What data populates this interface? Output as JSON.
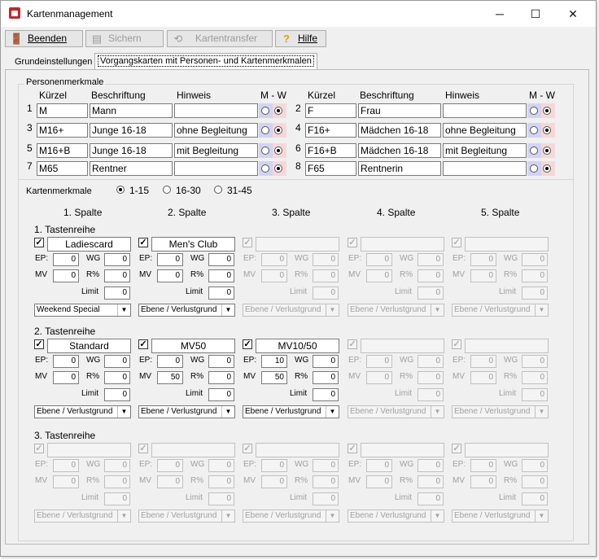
{
  "window": {
    "title": "Kartenmanagement",
    "minimize": "─",
    "maximize": "☐",
    "close": "✕"
  },
  "toolbar": {
    "beenden": "Beenden",
    "sichern": "Sichern",
    "kartentransfer": "Kartentransfer",
    "hilfe": "Hilfe"
  },
  "tabs": [
    "Grundeinstellungen",
    "Vorgangskarten mit Personen- und Kartenmerkmalen"
  ],
  "personen": {
    "legend": "Personenmerkmale",
    "headers": {
      "kuerzel": "Kürzel",
      "beschriftung": "Beschriftung",
      "hinweis": "Hinweis",
      "mw": "M - W"
    },
    "rows": [
      {
        "num": "1",
        "kuerzel": "M",
        "beschriftung": "Mann",
        "hinweis": "",
        "selected": "W"
      },
      {
        "num": "2",
        "kuerzel": "F",
        "beschriftung": "Frau",
        "hinweis": "",
        "selected": "W"
      },
      {
        "num": "3",
        "kuerzel": "M16+",
        "beschriftung": "Junge 16-18",
        "hinweis": "ohne Begleitung",
        "selected": "W"
      },
      {
        "num": "4",
        "kuerzel": "F16+",
        "beschriftung": "Mädchen 16-18",
        "hinweis": "ohne Begleitung",
        "selected": "W"
      },
      {
        "num": "5",
        "kuerzel": "M16+B",
        "beschriftung": "Junge 16-18",
        "hinweis": "mit Begleitung",
        "selected": "W"
      },
      {
        "num": "6",
        "kuerzel": "F16+B",
        "beschriftung": "Mädchen 16-18",
        "hinweis": "mit Begleitung",
        "selected": "W"
      },
      {
        "num": "7",
        "kuerzel": "M65",
        "beschriftung": "Rentner",
        "hinweis": "",
        "selected": "W"
      },
      {
        "num": "8",
        "kuerzel": "F65",
        "beschriftung": "Rentnerin",
        "hinweis": "",
        "selected": "W"
      }
    ],
    "mw_colors": {
      "m": "#d3d3f4",
      "w": "#f6d8d8"
    }
  },
  "kartenmerkmale": {
    "label": "Kartenmerkmale",
    "options": [
      "1-15",
      "16-30",
      "31-45"
    ],
    "selected": "1-15"
  },
  "spalten": [
    "1. Spalte",
    "2. Spalte",
    "3. Spalte",
    "4. Spalte",
    "5. Spalte"
  ],
  "field_labels": {
    "ep": "EP:",
    "wg": "WG",
    "mv": "MV",
    "r": "R%",
    "limit": "Limit"
  },
  "reihen": [
    {
      "title": "1. Tastenreihe",
      "cards": [
        {
          "enabled": true,
          "checked": true,
          "name": "Ladiescard",
          "ep": "0",
          "wg": "0",
          "mv": "0",
          "r": "0",
          "limit": "0",
          "select": "Weekend Special"
        },
        {
          "enabled": true,
          "checked": true,
          "name": "Men's Club",
          "ep": "0",
          "wg": "0",
          "mv": "0",
          "r": "0",
          "limit": "0",
          "select": "Ebene / Verlustgrund"
        },
        {
          "enabled": false,
          "checked": true,
          "name": "",
          "ep": "0",
          "wg": "0",
          "mv": "0",
          "r": "0",
          "limit": "0",
          "select": "Ebene / Verlustgrund"
        },
        {
          "enabled": false,
          "checked": true,
          "name": "",
          "ep": "0",
          "wg": "0",
          "mv": "0",
          "r": "0",
          "limit": "0",
          "select": "Ebene / Verlustgrund"
        },
        {
          "enabled": false,
          "checked": true,
          "name": "",
          "ep": "0",
          "wg": "0",
          "mv": "0",
          "r": "0",
          "limit": "0",
          "select": "Ebene / Verlustgrund"
        }
      ]
    },
    {
      "title": "2. Tastenreihe",
      "cards": [
        {
          "enabled": true,
          "checked": true,
          "name": "Standard",
          "ep": "0",
          "wg": "0",
          "mv": "0",
          "r": "0",
          "limit": "0",
          "select": "Ebene / Verlustgrund"
        },
        {
          "enabled": true,
          "checked": true,
          "name": "MV50",
          "ep": "0",
          "wg": "0",
          "mv": "50",
          "r": "0",
          "limit": "0",
          "select": "Ebene / Verlustgrund"
        },
        {
          "enabled": true,
          "checked": true,
          "name": "MV10/50",
          "ep": "10",
          "wg": "0",
          "mv": "50",
          "r": "0",
          "limit": "0",
          "select": "Ebene / Verlustgrund"
        },
        {
          "enabled": false,
          "checked": true,
          "name": "",
          "ep": "0",
          "wg": "0",
          "mv": "0",
          "r": "0",
          "limit": "0",
          "select": "Ebene / Verlustgrund"
        },
        {
          "enabled": false,
          "checked": true,
          "name": "",
          "ep": "0",
          "wg": "0",
          "mv": "0",
          "r": "0",
          "limit": "0",
          "select": "Ebene / Verlustgrund"
        }
      ]
    },
    {
      "title": "3. Tastenreihe",
      "cards": [
        {
          "enabled": false,
          "checked": true,
          "name": "",
          "ep": "0",
          "wg": "0",
          "mv": "0",
          "r": "0",
          "limit": "0",
          "select": "Ebene / Verlustgrund"
        },
        {
          "enabled": false,
          "checked": true,
          "name": "",
          "ep": "0",
          "wg": "0",
          "mv": "0",
          "r": "0",
          "limit": "0",
          "select": "Ebene / Verlustgrund"
        },
        {
          "enabled": false,
          "checked": true,
          "name": "",
          "ep": "0",
          "wg": "0",
          "mv": "0",
          "r": "0",
          "limit": "0",
          "select": "Ebene / Verlustgrund"
        },
        {
          "enabled": false,
          "checked": true,
          "name": "",
          "ep": "0",
          "wg": "0",
          "mv": "0",
          "r": "0",
          "limit": "0",
          "select": "Ebene / Verlustgrund"
        },
        {
          "enabled": false,
          "checked": true,
          "name": "",
          "ep": "0",
          "wg": "0",
          "mv": "0",
          "r": "0",
          "limit": "0",
          "select": "Ebene / Verlustgrund"
        }
      ]
    }
  ]
}
